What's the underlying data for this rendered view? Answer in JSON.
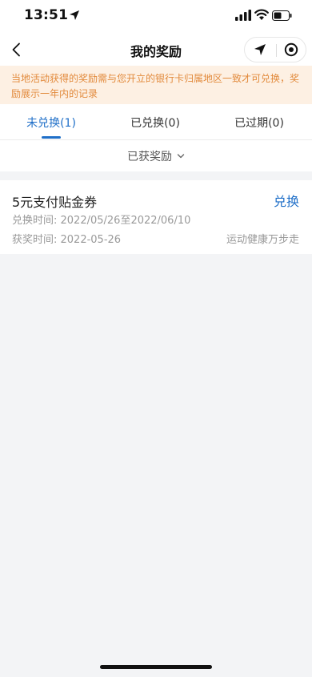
{
  "status_bar": {
    "time": "13:51"
  },
  "nav": {
    "title": "我的奖励"
  },
  "notice": {
    "text": "当地活动获得的奖励需与您开立的银行卡归属地区一致才可兑换，奖励展示一年内的记录"
  },
  "tabs": [
    {
      "label": "未兑换(1)",
      "active": true
    },
    {
      "label": "已兑换(0)",
      "active": false
    },
    {
      "label": "已过期(0)",
      "active": false
    }
  ],
  "filter": {
    "label": "已获奖励"
  },
  "reward_card": {
    "title": "5元支付贴金券",
    "action_label": "兑换",
    "exchange_period": "兑换时间: 2022/05/26至2022/06/10",
    "award_time": "获奖时间: 2022-05-26",
    "source": "运动健康万步走"
  },
  "colors": {
    "accent": "#1f6fc8",
    "notice_text": "#e28a3c",
    "notice_bg": "#fdf0e3",
    "page_bg": "#f3f4f6"
  }
}
